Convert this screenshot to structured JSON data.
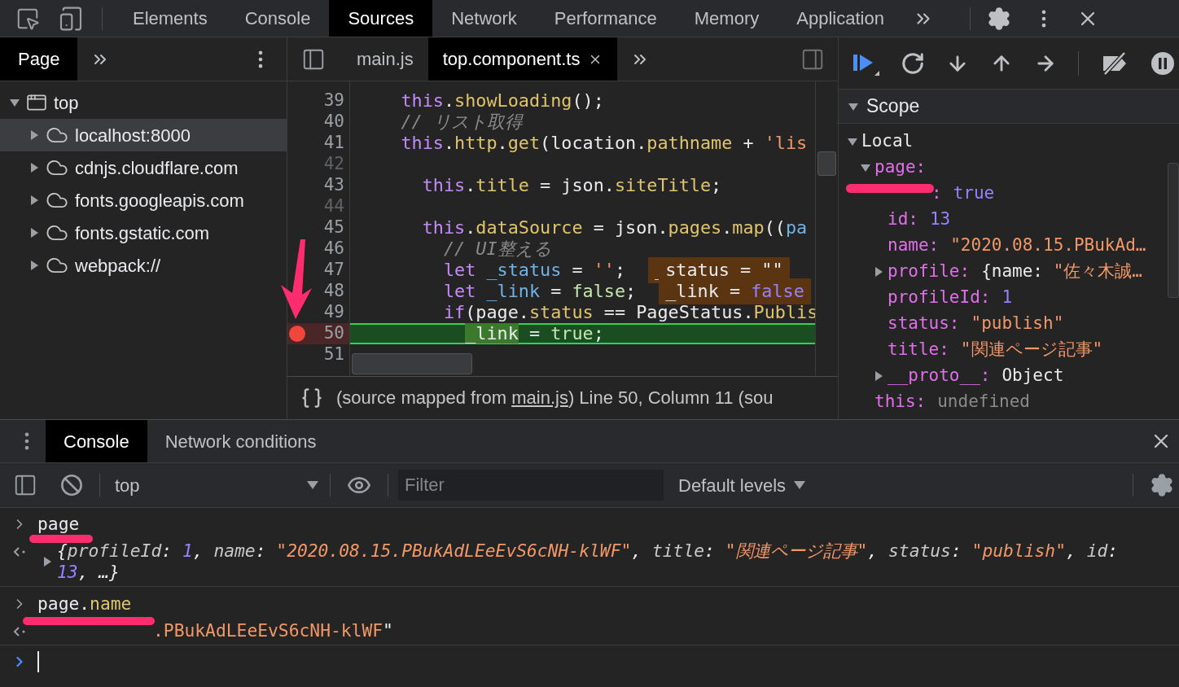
{
  "main_tabs": [
    {
      "label": "Elements",
      "selected": false
    },
    {
      "label": "Console",
      "selected": false
    },
    {
      "label": "Sources",
      "selected": true
    },
    {
      "label": "Network",
      "selected": false
    },
    {
      "label": "Performance",
      "selected": false
    },
    {
      "label": "Memory",
      "selected": false
    },
    {
      "label": "Application",
      "selected": false
    }
  ],
  "navigator": {
    "tabs": [
      {
        "label": "Page",
        "selected": true
      }
    ],
    "tree": [
      {
        "label": "top",
        "kind": "frame",
        "expanded": true,
        "selected": false,
        "children": [
          {
            "label": "localhost:8000",
            "kind": "origin",
            "expanded": false,
            "selected": true
          },
          {
            "label": "cdnjs.cloudflare.com",
            "kind": "origin",
            "expanded": false,
            "selected": false
          },
          {
            "label": "fonts.googleapis.com",
            "kind": "origin",
            "expanded": false,
            "selected": false
          },
          {
            "label": "fonts.gstatic.com",
            "kind": "origin",
            "expanded": false,
            "selected": false
          },
          {
            "label": "webpack://",
            "kind": "origin",
            "expanded": false,
            "selected": false
          }
        ]
      }
    ]
  },
  "editor": {
    "tabs": [
      {
        "label": "main.js",
        "selected": false
      },
      {
        "label": "top.component.ts",
        "selected": true
      }
    ],
    "lines": [
      {
        "number": "39",
        "faded": false,
        "current": false,
        "breakpoint": false,
        "tokens": [
          {
            "t": "    this",
            "kind": "kw"
          },
          {
            "t": ".",
            "kind": "plain"
          },
          {
            "t": "showLoading",
            "kind": "fn"
          },
          {
            "t": "();",
            "kind": "plain"
          }
        ]
      },
      {
        "number": "40",
        "faded": false,
        "current": false,
        "breakpoint": false,
        "tokens": [
          {
            "t": "    // リスト取得",
            "kind": "comment"
          }
        ]
      },
      {
        "number": "41",
        "faded": false,
        "current": false,
        "breakpoint": false,
        "tokens": [
          {
            "t": "    this",
            "kind": "kw"
          },
          {
            "t": ".",
            "kind": "plain"
          },
          {
            "t": "http",
            "kind": "fn"
          },
          {
            "t": ".",
            "kind": "plain"
          },
          {
            "t": "get",
            "kind": "fn"
          },
          {
            "t": "(location.",
            "kind": "plain"
          },
          {
            "t": "pathname",
            "kind": "fn"
          },
          {
            "t": " + ",
            "kind": "plain"
          },
          {
            "t": "'lis",
            "kind": "str"
          }
        ]
      },
      {
        "number": "42",
        "faded": true,
        "current": false,
        "breakpoint": false
      },
      {
        "number": "43",
        "faded": false,
        "current": false,
        "breakpoint": false,
        "tokens": [
          {
            "t": "      this",
            "kind": "kw"
          },
          {
            "t": ".",
            "kind": "plain"
          },
          {
            "t": "title",
            "kind": "fn"
          },
          {
            "t": " = json.",
            "kind": "plain"
          },
          {
            "t": "siteTitle",
            "kind": "fn"
          },
          {
            "t": ";",
            "kind": "plain"
          }
        ]
      },
      {
        "number": "44",
        "faded": true,
        "current": false,
        "breakpoint": false
      },
      {
        "number": "45",
        "faded": false,
        "current": false,
        "breakpoint": false,
        "tokens": [
          {
            "t": "      this",
            "kind": "kw"
          },
          {
            "t": ".",
            "kind": "plain"
          },
          {
            "t": "dataSource",
            "kind": "fn"
          },
          {
            "t": " = json.",
            "kind": "plain"
          },
          {
            "t": "pages",
            "kind": "fn"
          },
          {
            "t": ".",
            "kind": "plain"
          },
          {
            "t": "map",
            "kind": "fn"
          },
          {
            "t": "((",
            "kind": "plain"
          },
          {
            "t": "pa",
            "kind": "var"
          }
        ]
      },
      {
        "number": "46",
        "faded": false,
        "current": false,
        "breakpoint": false,
        "tokens": [
          {
            "t": "        // UI整える",
            "kind": "comment"
          }
        ]
      },
      {
        "number": "47",
        "faded": false,
        "current": false,
        "breakpoint": false,
        "tokens": [
          {
            "t": "        let",
            "kind": "kw"
          },
          {
            "t": " _status",
            "kind": "var"
          },
          {
            "t": " = ",
            "kind": "plain"
          },
          {
            "t": "''",
            "kind": "str"
          },
          {
            "t": ";",
            "kind": "plain"
          }
        ],
        "inline_value": [
          {
            "t": "_status = \"\"",
            "kind": "plain"
          }
        ]
      },
      {
        "number": "48",
        "faded": false,
        "current": false,
        "breakpoint": false,
        "tokens": [
          {
            "t": "        let",
            "kind": "kw"
          },
          {
            "t": " _link",
            "kind": "var"
          },
          {
            "t": " = ",
            "kind": "plain"
          },
          {
            "t": "false",
            "kind": "bool"
          },
          {
            "t": ";",
            "kind": "plain"
          }
        ],
        "inline_value": [
          {
            "t": "_link = ",
            "kind": "plain"
          },
          {
            "t": "false",
            "kind": "num"
          }
        ]
      },
      {
        "number": "49",
        "faded": false,
        "current": false,
        "breakpoint": false,
        "tokens": [
          {
            "t": "        if",
            "kind": "kw"
          },
          {
            "t": "(page.",
            "kind": "plain"
          },
          {
            "t": "status",
            "kind": "fn"
          },
          {
            "t": " == PageStatus.",
            "kind": "plain"
          },
          {
            "t": "Publis",
            "kind": "fn"
          }
        ]
      },
      {
        "number": "50",
        "faded": false,
        "current": true,
        "breakpoint": true,
        "tokens": [
          {
            "t": "          _link",
            "kind": "hl"
          },
          {
            "t": " = ",
            "kind": "plain"
          },
          {
            "t": "true",
            "kind": "bool"
          },
          {
            "t": ";",
            "kind": "plain"
          }
        ]
      },
      {
        "number": "51",
        "faded": false,
        "current": false,
        "breakpoint": false
      }
    ],
    "status": {
      "prefix": "(source mapped from ",
      "link": "main.js",
      "suffix": ") Line 50, Column 11  (sou"
    }
  },
  "scope": {
    "title": "Scope",
    "expanded": true,
    "tree": [
      {
        "key": "Local",
        "kind": "section",
        "expanded": true,
        "children": [
          {
            "key": "page:",
            "expanded": true,
            "children": [
              {
                "key": ":",
                "covered": true,
                "value": [
                  {
                    "t": "true",
                    "kind": "num"
                  }
                ]
              },
              {
                "key": "id:",
                "value": [
                  {
                    "t": "13",
                    "kind": "num"
                  }
                ]
              },
              {
                "key": "name:",
                "value": [
                  {
                    "t": "\"2020.08.15.PBukAd…",
                    "kind": "str"
                  }
                ]
              },
              {
                "key": "profile:",
                "expanded": false,
                "value": [
                  {
                    "t": "{name: ",
                    "kind": "plain"
                  },
                  {
                    "t": "\"佐々木誠…",
                    "kind": "str"
                  }
                ]
              },
              {
                "key": "profileId:",
                "value": [
                  {
                    "t": "1",
                    "kind": "num"
                  }
                ]
              },
              {
                "key": "status:",
                "value": [
                  {
                    "t": "\"publish\"",
                    "kind": "str"
                  }
                ]
              },
              {
                "key": "title:",
                "value": [
                  {
                    "t": "\"関連ページ記事\"",
                    "kind": "str"
                  }
                ]
              },
              {
                "key": "__proto__:",
                "expanded": false,
                "value": [
                  {
                    "t": "Object",
                    "kind": "plain"
                  }
                ]
              }
            ]
          },
          {
            "key": "this:",
            "value": [
              {
                "t": "undefined",
                "kind": "undef"
              }
            ]
          }
        ]
      }
    ]
  },
  "drawer": {
    "tabs": [
      {
        "label": "Console",
        "selected": true
      },
      {
        "label": "Network conditions",
        "selected": false
      }
    ],
    "context": "top",
    "filter": {
      "placeholder": "Filter"
    },
    "levels": "Default levels",
    "messages": [
      {
        "kind": "input",
        "tokens": [
          {
            "t": "page",
            "kind": "plain"
          }
        ]
      },
      {
        "kind": "output",
        "expanded": false,
        "tokens": [
          {
            "t": "{",
            "kind": "plain"
          },
          {
            "t": "profileId",
            "kind": "key"
          },
          {
            "t": ": ",
            "kind": "plain"
          },
          {
            "t": "1",
            "kind": "num"
          },
          {
            "t": ", ",
            "kind": "plain"
          },
          {
            "t": "name",
            "kind": "key"
          },
          {
            "t": ": ",
            "kind": "plain"
          },
          {
            "t": "\"2020.08.15.PBukAdLEeEvS6cNH-klWF\"",
            "kind": "str"
          },
          {
            "t": ", ",
            "kind": "plain"
          },
          {
            "t": "title",
            "kind": "key"
          },
          {
            "t": ": ",
            "kind": "plain"
          },
          {
            "t": "\"関連ページ記事\"",
            "kind": "str"
          },
          {
            "t": ", ",
            "kind": "plain"
          },
          {
            "t": "status",
            "kind": "key"
          },
          {
            "t": ": ",
            "kind": "plain"
          },
          {
            "t": "\"publish\"",
            "kind": "str"
          },
          {
            "t": ", ",
            "kind": "plain"
          },
          {
            "t": "id",
            "kind": "key"
          },
          {
            "t": ": ",
            "kind": "plain"
          },
          {
            "t": "13",
            "kind": "num"
          },
          {
            "t": ", …}",
            "kind": "plain"
          }
        ]
      },
      {
        "kind": "input",
        "tokens": [
          {
            "t": "page.",
            "kind": "plain"
          },
          {
            "t": "name",
            "kind": "prop"
          }
        ]
      },
      {
        "kind": "output",
        "covered": true,
        "tokens": [
          {
            "t": ".PBukAdLEeEvS6cNH-klWF",
            "kind": "str"
          },
          {
            "t": "\"",
            "kind": "plain"
          }
        ]
      }
    ]
  }
}
